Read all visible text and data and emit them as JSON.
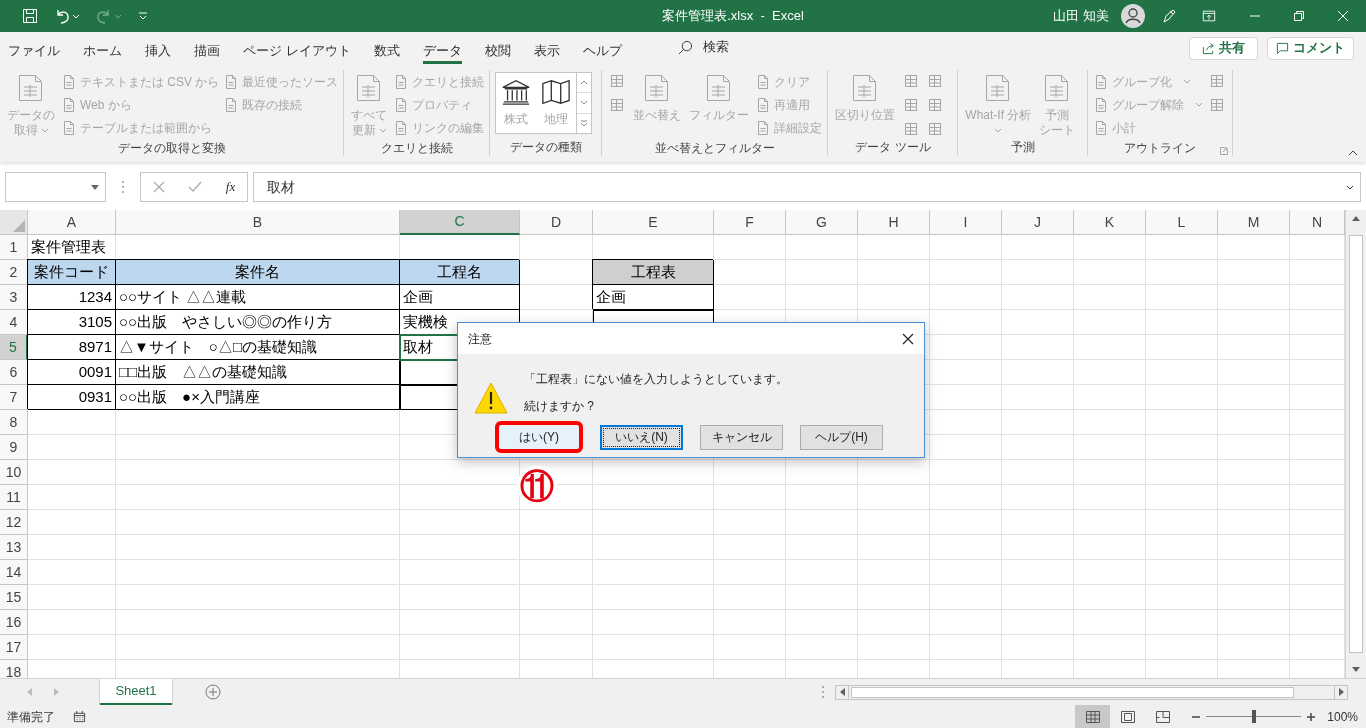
{
  "title_bar": {
    "quick_access": [
      {
        "kind": "save",
        "disabled": false
      },
      {
        "kind": "undo",
        "disabled": false
      },
      {
        "kind": "redo",
        "disabled": true
      },
      {
        "kind": "customize",
        "disabled": false
      }
    ],
    "title": "案件管理表.xlsx  -  Excel",
    "user": "山田 知美"
  },
  "ribbon_tabs": [
    {
      "label": "ファイル",
      "selected": false
    },
    {
      "label": "ホーム",
      "selected": false
    },
    {
      "label": "挿入",
      "selected": false
    },
    {
      "label": "描画",
      "selected": false
    },
    {
      "label": "ページ レイアウト",
      "selected": false
    },
    {
      "label": "数式",
      "selected": false
    },
    {
      "label": "データ",
      "selected": true
    },
    {
      "label": "校閲",
      "selected": false
    },
    {
      "label": "表示",
      "selected": false
    },
    {
      "label": "ヘルプ",
      "selected": false
    }
  ],
  "search": {
    "label": "検索"
  },
  "share_button": "共有",
  "comment_button": "コメント",
  "ribbon_groups": [
    {
      "label": "データの取得と変換",
      "launcher": false,
      "sections": [
        {
          "kind": "large",
          "label": [
            "データの",
            "取得"
          ],
          "dropdown": true,
          "disabled": true
        },
        {
          "kind": "stack",
          "items": [
            {
              "label": "テキストまたは CSV から",
              "dropdown": false,
              "disabled": true
            },
            {
              "label": "Web から",
              "dropdown": false,
              "disabled": true
            },
            {
              "label": "テーブルまたは範囲から",
              "dropdown": false,
              "disabled": true
            }
          ]
        },
        {
          "kind": "stack",
          "items": [
            {
              "label": "最近使ったソース",
              "dropdown": false,
              "disabled": true
            },
            {
              "label": "既存の接続",
              "dropdown": false,
              "disabled": true
            }
          ]
        }
      ]
    },
    {
      "label": "クエリと接続",
      "launcher": false,
      "sections": [
        {
          "kind": "large",
          "label": [
            "すべて",
            "更新"
          ],
          "dropdown": true,
          "disabled": true
        },
        {
          "kind": "stack",
          "items": [
            {
              "label": "クエリと接続",
              "dropdown": false,
              "disabled": true
            },
            {
              "label": "プロパティ",
              "dropdown": false,
              "disabled": true
            },
            {
              "label": "リンクの編集",
              "dropdown": false,
              "disabled": true
            }
          ]
        }
      ]
    },
    {
      "label": "データの種類",
      "launcher": false,
      "sections": [
        {
          "kind": "gallery",
          "items": [
            {
              "label": "株式"
            },
            {
              "label": "地理"
            }
          ]
        }
      ]
    },
    {
      "label": "並べ替えとフィルター",
      "launcher": false,
      "sections": [
        {
          "kind": "icons",
          "items": [
            {
              "disabled": true
            },
            {
              "disabled": true
            }
          ]
        },
        {
          "kind": "large",
          "label": [
            "並べ替え"
          ],
          "dropdown": false,
          "disabled": true
        },
        {
          "kind": "large",
          "label": [
            "フィルター"
          ],
          "dropdown": false,
          "disabled": true
        },
        {
          "kind": "stack",
          "items": [
            {
              "label": "クリア",
              "dropdown": false,
              "disabled": true
            },
            {
              "label": "再適用",
              "dropdown": false,
              "disabled": true
            },
            {
              "label": "詳細設定",
              "dropdown": false,
              "disabled": true
            }
          ]
        }
      ]
    },
    {
      "label": "データ ツール",
      "launcher": false,
      "sections": [
        {
          "kind": "large",
          "label": [
            "区切り位置"
          ],
          "dropdown": false,
          "disabled": true
        },
        {
          "kind": "icons",
          "items": [
            {
              "disabled": true
            },
            {
              "disabled": true
            },
            {
              "disabled": true
            }
          ]
        },
        {
          "kind": "icons",
          "items": [
            {
              "disabled": true
            },
            {
              "disabled": true
            },
            {
              "disabled": true
            }
          ]
        }
      ]
    },
    {
      "label": "予測",
      "launcher": false,
      "sections": [
        {
          "kind": "large",
          "label": [
            "What-If 分析"
          ],
          "dropdown": true,
          "disabled": true
        },
        {
          "kind": "large",
          "label": [
            "予測",
            "シート"
          ],
          "dropdown": false,
          "disabled": true
        }
      ]
    },
    {
      "label": "アウトライン",
      "launcher": true,
      "sections": [
        {
          "kind": "stack",
          "items": [
            {
              "label": "グループ化",
              "dropdown": true,
              "disabled": true
            },
            {
              "label": "グループ解除",
              "dropdown": true,
              "disabled": true
            },
            {
              "label": "小計",
              "dropdown": false,
              "disabled": true
            }
          ]
        },
        {
          "kind": "icons",
          "items": [
            {
              "disabled": true
            },
            {
              "disabled": true
            }
          ]
        }
      ]
    }
  ],
  "formula_bar": {
    "function_label": "fx",
    "value": "取材"
  },
  "sheet": {
    "columns": [
      {
        "label": "A",
        "selected": false
      },
      {
        "label": "B",
        "selected": false
      },
      {
        "label": "C",
        "selected": true
      },
      {
        "label": "D",
        "selected": false
      },
      {
        "label": "E",
        "selected": false
      },
      {
        "label": "F",
        "selected": false
      },
      {
        "label": "G",
        "selected": false
      },
      {
        "label": "H",
        "selected": false
      },
      {
        "label": "I",
        "selected": false
      },
      {
        "label": "J",
        "selected": false
      },
      {
        "label": "K",
        "selected": false
      },
      {
        "label": "L",
        "selected": false
      },
      {
        "label": "M",
        "selected": false
      },
      {
        "label": "N",
        "selected": false
      }
    ],
    "rows": [
      {
        "number": "1",
        "selected": false,
        "cells": [
          {
            "kind": "title",
            "text": "案件管理表"
          }
        ]
      },
      {
        "number": "2",
        "selected": false,
        "cells": [
          {
            "kind": "header",
            "text": "案件コード"
          },
          {
            "kind": "header",
            "text": "案件名"
          },
          {
            "kind": "header",
            "text": "工程名"
          },
          null,
          {
            "kind": "list_header",
            "text": "工程表"
          }
        ]
      },
      {
        "number": "3",
        "selected": false,
        "cells": [
          {
            "kind": "number",
            "text": "1234"
          },
          {
            "kind": "text",
            "text": "○○サイト △△連載"
          },
          {
            "kind": "text",
            "text": "企画"
          },
          null,
          {
            "kind": "text",
            "text": "企画"
          }
        ]
      },
      {
        "number": "4",
        "selected": false,
        "cells": [
          {
            "kind": "number",
            "text": "3105"
          },
          {
            "kind": "text",
            "text": "○○出版　やさしい◎◎の作り方"
          },
          {
            "kind": "text",
            "text": "実機検"
          },
          null,
          {
            "kind": "blank"
          }
        ]
      },
      {
        "number": "5",
        "selected": true,
        "cells": [
          {
            "kind": "number",
            "text": "8971"
          },
          {
            "kind": "text",
            "text": "△▼サイト　○△□の基礎知識"
          },
          {
            "kind": "text",
            "text": "取材"
          }
        ]
      },
      {
        "number": "6",
        "selected": false,
        "cells": [
          {
            "kind": "number",
            "text": "0091"
          },
          {
            "kind": "text",
            "text": "□□出版　△△の基礎知識"
          },
          {
            "kind": "blank"
          }
        ]
      },
      {
        "number": "7",
        "selected": false,
        "cells": [
          {
            "kind": "number",
            "text": "0931"
          },
          {
            "kind": "text",
            "text": "○○出版　●×入門講座"
          },
          {
            "kind": "blank"
          }
        ]
      },
      {
        "number": "8",
        "selected": false
      },
      {
        "number": "9",
        "selected": false
      },
      {
        "number": "10",
        "selected": false
      },
      {
        "number": "11",
        "selected": false
      },
      {
        "number": "12",
        "selected": false
      },
      {
        "number": "13",
        "selected": false
      },
      {
        "number": "14",
        "selected": false
      },
      {
        "number": "15",
        "selected": false
      },
      {
        "number": "16",
        "selected": false
      },
      {
        "number": "17",
        "selected": false
      },
      {
        "number": "18",
        "selected": false
      }
    ]
  },
  "dialog": {
    "title": "注意",
    "message": "「工程表」にない値を入力しようとしています。",
    "question": "続けますか ?",
    "buttons": [
      {
        "label": "はい(Y)",
        "focused": false,
        "highlighted": true
      },
      {
        "label": "いいえ(N)",
        "focused": true,
        "highlighted": false
      },
      {
        "label": "キャンセル",
        "focused": false,
        "highlighted": false
      },
      {
        "label": "ヘルプ(H)",
        "focused": false,
        "highlighted": false
      }
    ]
  },
  "annotation": {
    "marker": "⑪"
  },
  "sheet_tabs": [
    {
      "label": "Sheet1",
      "selected": true
    }
  ],
  "status_bar": {
    "status": "準備完了",
    "views": [
      {
        "kind": "normal",
        "selected": true
      },
      {
        "kind": "page_layout",
        "selected": false
      },
      {
        "kind": "page_break",
        "selected": false
      }
    ],
    "zoom": {
      "level": 0.5,
      "reading": "100%"
    }
  }
}
